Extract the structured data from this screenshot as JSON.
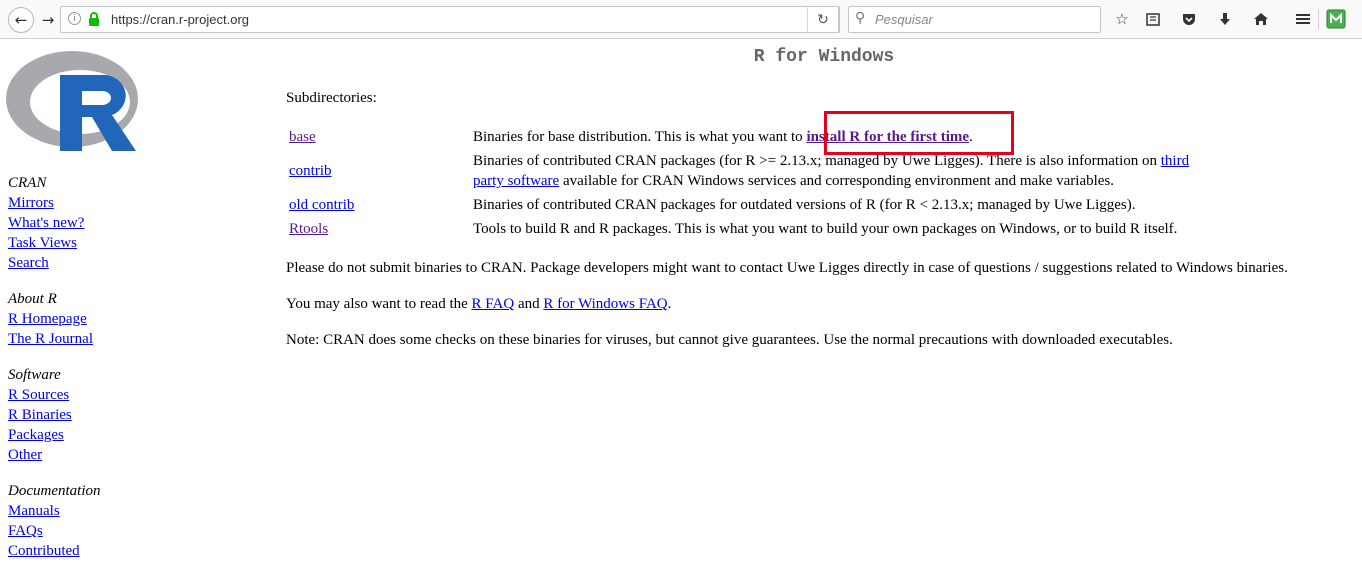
{
  "browser": {
    "url": "https://cran.r-project.org",
    "search_placeholder": "Pesquisar",
    "info_icon_glyph": "i"
  },
  "sidebar": {
    "groups": [
      {
        "heading": "CRAN",
        "links": [
          "Mirrors",
          "What's new?",
          "Task Views",
          "Search"
        ]
      },
      {
        "heading": "About R",
        "links": [
          "R Homepage",
          "The R Journal"
        ]
      },
      {
        "heading": "Software",
        "links": [
          "R Sources",
          "R Binaries",
          "Packages",
          "Other"
        ]
      },
      {
        "heading": "Documentation",
        "links": [
          "Manuals",
          "FAQs",
          "Contributed"
        ]
      }
    ]
  },
  "main": {
    "title": "R for Windows",
    "subdirectories_label": "Subdirectories:",
    "dirs": [
      {
        "name": "base",
        "desc_pre": "Binaries for base distribution. This is what you want to ",
        "desc_link": "install R for the first time",
        "desc_post": "."
      },
      {
        "name": "contrib",
        "desc_pre": "Binaries of contributed CRAN packages (for R >= 2.13.x; managed by Uwe Ligges). There is also information on ",
        "desc_link1": "third",
        "desc_link2": "party software",
        "desc_post": " available for CRAN Windows services and corresponding environment and make variables."
      },
      {
        "name": "old contrib",
        "desc": "Binaries of contributed CRAN packages for outdated versions of R (for R < 2.13.x; managed by Uwe Ligges)."
      },
      {
        "name": "Rtools",
        "desc": "Tools to build R and R packages. This is what you want to build your own packages on Windows, or to build R itself."
      }
    ],
    "para1": "Please do not submit binaries to CRAN. Package developers might want to contact Uwe Ligges directly in case of questions / suggestions related to Windows binaries.",
    "para2_pre": "You may also want to read the ",
    "para2_link1": "R FAQ",
    "para2_mid": " and ",
    "para2_link2": "R for Windows FAQ",
    "para2_post": ".",
    "para3": "Note: CRAN does some checks on these binaries for viruses, but cannot give guarantees. Use the normal precautions with downloaded executables."
  },
  "colors": {
    "link": "#0000ee",
    "visited_link": "#551a8b",
    "highlight_box": "#e5001b",
    "r_logo_blue": "#2166b8",
    "r_logo_gray": "#a8a9ad"
  }
}
